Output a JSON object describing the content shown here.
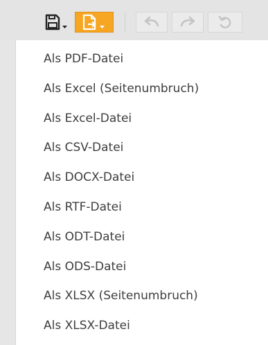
{
  "toolbar": {
    "buttons": [
      {
        "name": "save",
        "icon": "save-icon"
      },
      {
        "name": "export",
        "icon": "export-file-icon"
      },
      {
        "name": "undo",
        "icon": "undo-icon"
      },
      {
        "name": "redo",
        "icon": "redo-icon"
      },
      {
        "name": "refresh",
        "icon": "refresh-icon"
      }
    ],
    "accent_color": "#f6a623"
  },
  "export_menu": {
    "items": [
      "Als PDF-Datei",
      "Als Excel (Seitenumbruch)",
      "Als Excel-Datei",
      "Als CSV-Datei",
      "Als DOCX-Datei",
      "Als RTF-Datei",
      "Als ODT-Datei",
      "Als ODS-Datei",
      "Als XLSX (Seitenumbruch)",
      "Als XLSX-Datei"
    ]
  }
}
